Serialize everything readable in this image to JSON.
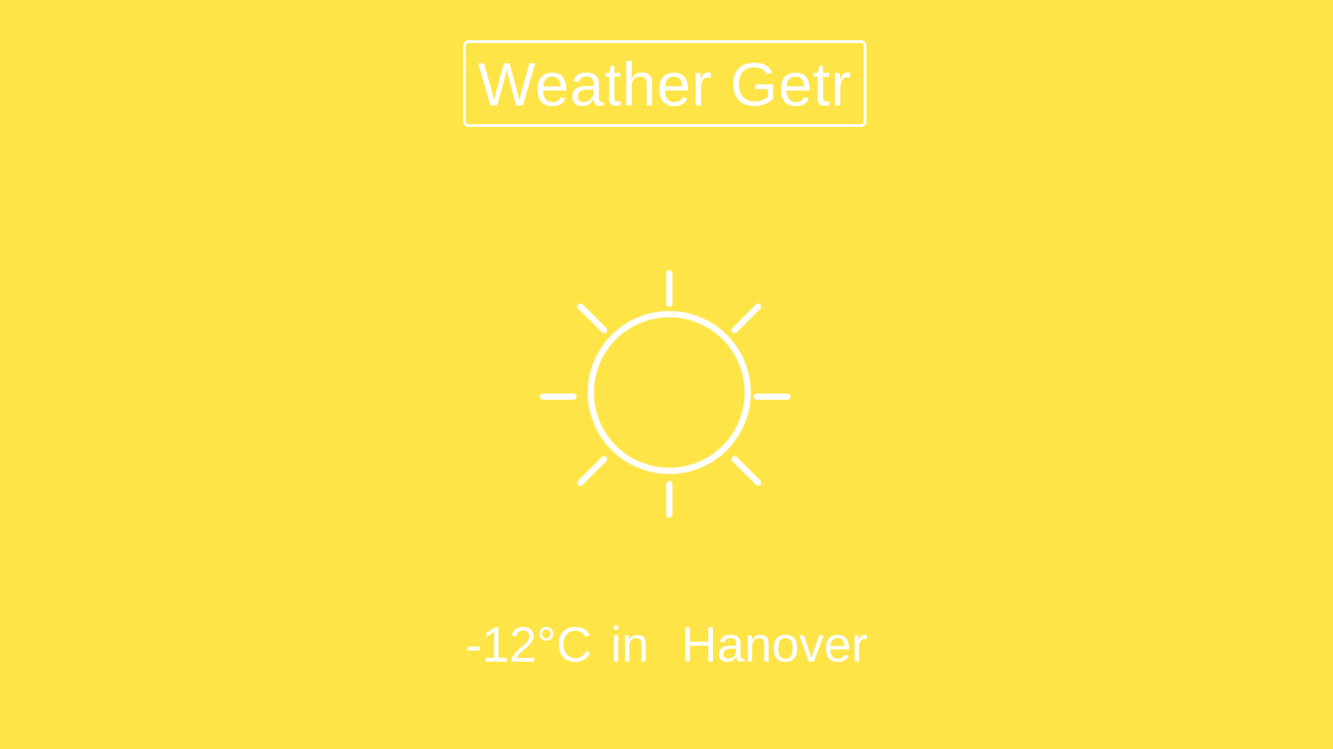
{
  "app": {
    "title": "Weather Getr",
    "background_color": "#FFE447",
    "foreground_color": "#FFFFFF"
  },
  "weather": {
    "icon": "sun-icon",
    "temperature": "-12°C",
    "connector": "in",
    "location": "Hanover"
  }
}
